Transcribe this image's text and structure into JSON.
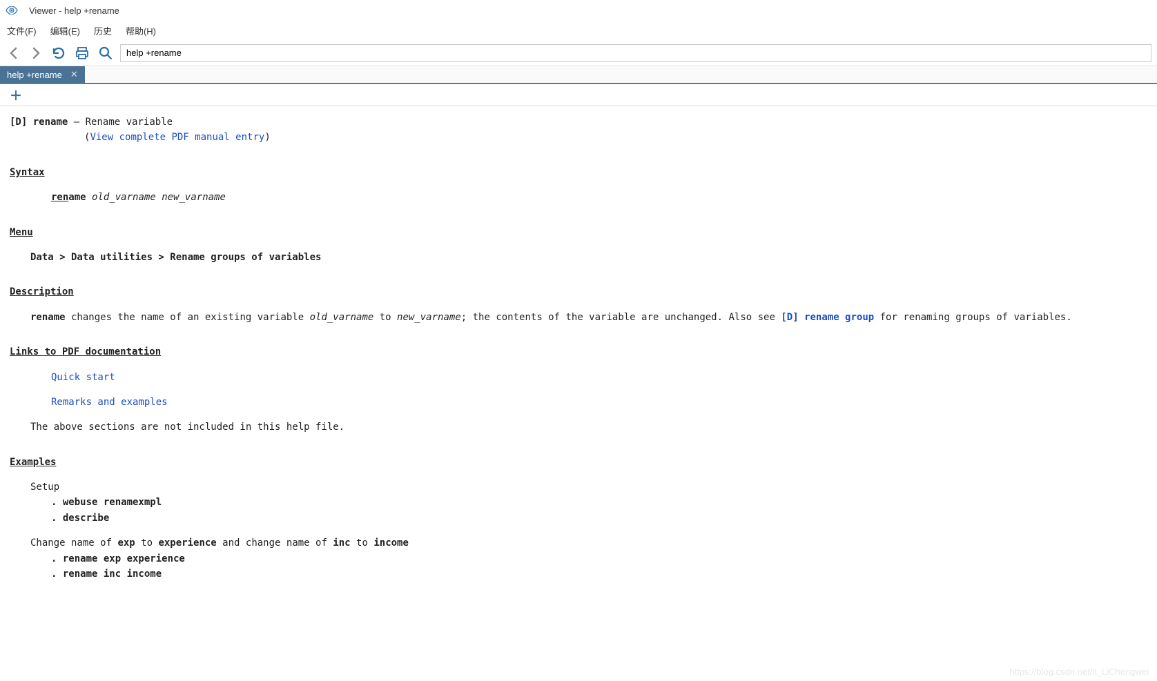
{
  "window": {
    "title": "Viewer - help +rename"
  },
  "menu": {
    "file": "文件(F)",
    "edit": "编辑(E)",
    "history": "历史",
    "help": "帮助(H)"
  },
  "toolbar": {
    "address_value": "help +rename"
  },
  "tab": {
    "label": "help +rename"
  },
  "content": {
    "header_prefix": "[D]",
    "header_cmd": "rename",
    "header_dash": " — ",
    "header_desc": "Rename variable",
    "pdf_link": "View complete PDF manual entry",
    "syntax_head": "Syntax",
    "syntax_cmd_u": "ren",
    "syntax_cmd_rest": "ame",
    "syntax_arg1": "old_varname",
    "syntax_arg2": "new_varname",
    "menu_head": "Menu",
    "menu_path": "Data > Data utilities > Rename groups of variables",
    "desc_head": "Description",
    "desc_cmd": "rename",
    "desc_text1": " changes the name of an existing variable ",
    "desc_old": "old_varname",
    "desc_text2": " to ",
    "desc_new": "new_varname",
    "desc_text3": "; the contents of the variable are unchanged.  Also see ",
    "desc_link": "[D] rename group",
    "desc_text4": " for renaming groups of variables.",
    "links_head": "Links to PDF documentation",
    "link_qs": "Quick start",
    "link_re": "Remarks and examples",
    "links_note": "The above sections are not included in this help file.",
    "ex_head": "Examples",
    "ex_setup": "Setup",
    "ex_cmd1": ". webuse renamexmpl",
    "ex_cmd2": ". describe",
    "ex_change_t1": "Change name of ",
    "ex_change_b1": "exp",
    "ex_change_t2": " to ",
    "ex_change_b2": "experience",
    "ex_change_t3": " and change name of ",
    "ex_change_b3": "inc",
    "ex_change_t4": " to ",
    "ex_change_b4": "income",
    "ex_cmd3": ". rename exp experience",
    "ex_cmd4": ". rename inc income"
  },
  "watermark": "https://blog.csdn.net/lt_LiChengwei"
}
